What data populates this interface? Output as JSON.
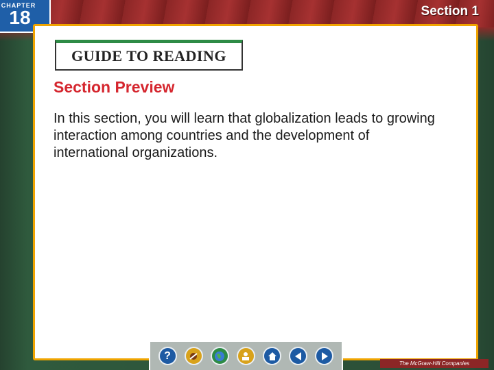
{
  "header": {
    "chapter_label": "CHAPTER",
    "chapter_number": "18",
    "section_label": "Section 1"
  },
  "guide": {
    "title": "GUIDE TO READING"
  },
  "content": {
    "heading": "Section Preview",
    "body": "In this section, you will learn that globalization leads to growing interaction among countries and the development of international organizations."
  },
  "navbar": {
    "help_label": "?",
    "icons": [
      "help-icon",
      "resources-icon",
      "globe-icon",
      "teacher-icon",
      "home-icon",
      "previous-icon",
      "next-icon"
    ]
  },
  "footer": {
    "publisher": "The McGraw-Hill Companies"
  },
  "colors": {
    "accent_red": "#d5262e",
    "border_gold": "#f0a400",
    "nav_blue": "#1d5aa3",
    "guide_green": "#2e8b46"
  }
}
